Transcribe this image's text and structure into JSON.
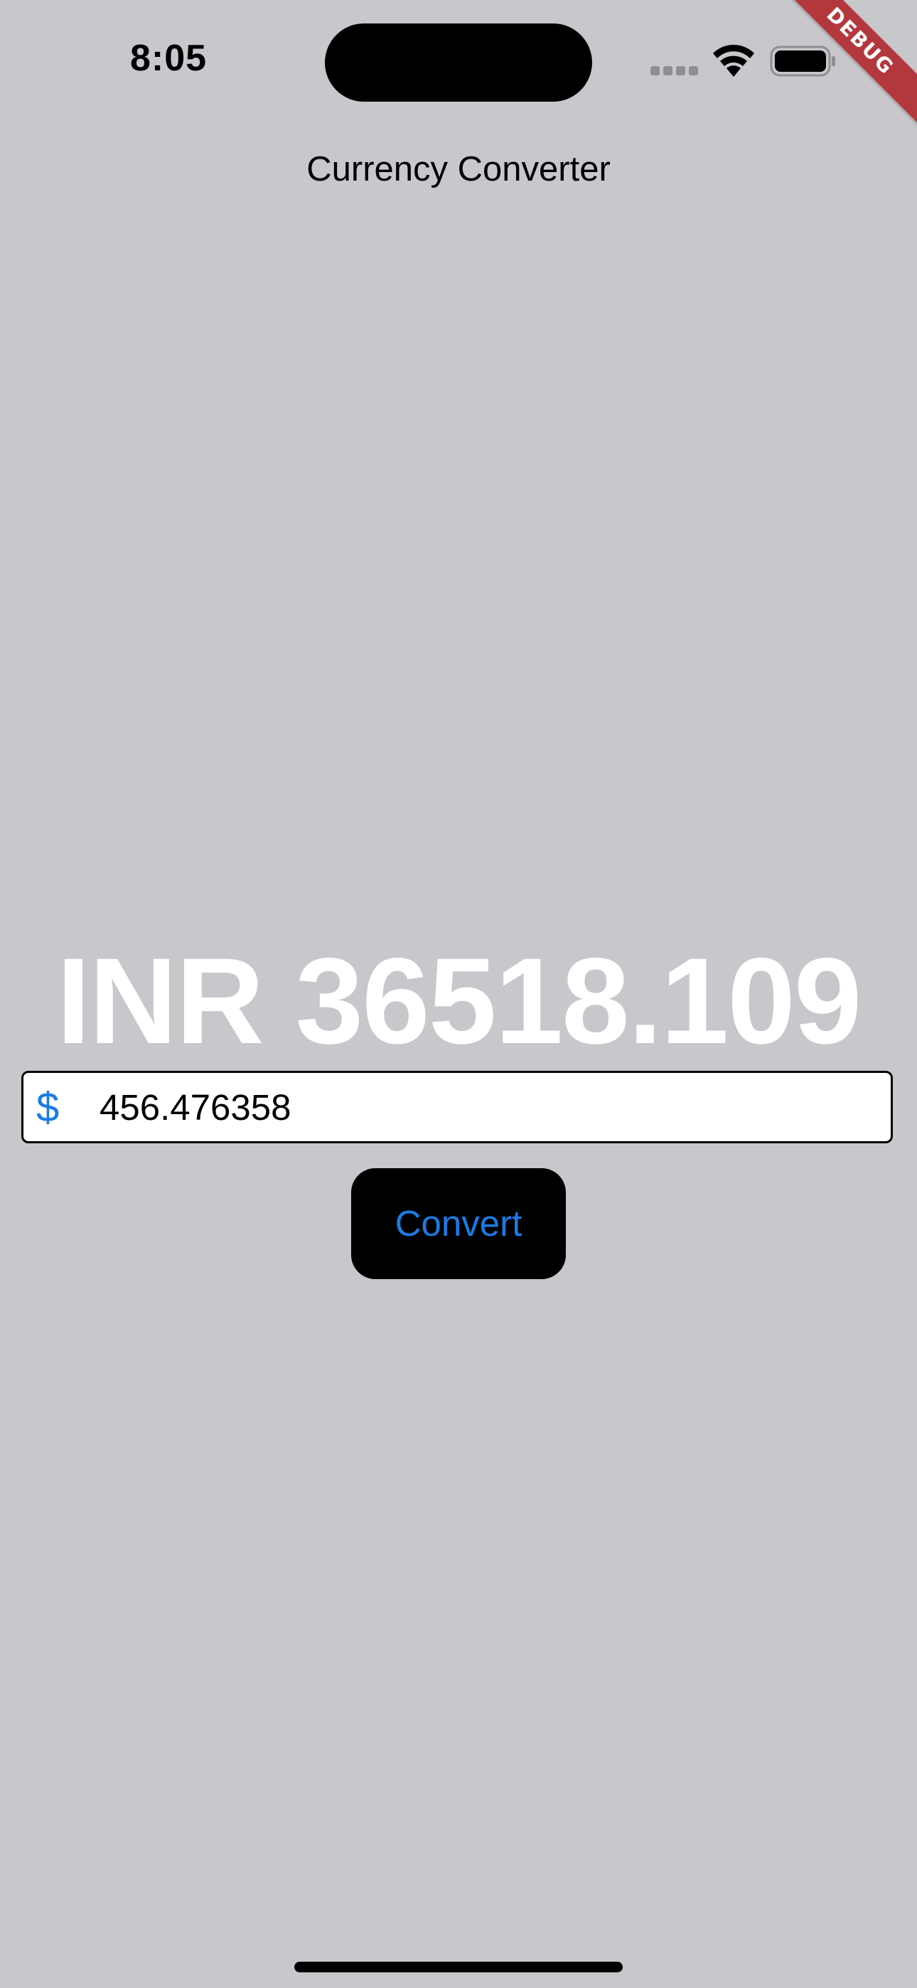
{
  "status_bar": {
    "time": "8:05",
    "icons": [
      "cellular-signal-icon",
      "wifi-icon",
      "battery-icon"
    ]
  },
  "debug_banner": {
    "label": "DEBUG",
    "color": "#b3383d"
  },
  "app_bar": {
    "title": "Currency Converter"
  },
  "result": {
    "text": "INR 36518.109"
  },
  "amount_field": {
    "prefix": "$",
    "value": "456.476358"
  },
  "convert_button": {
    "label": "Convert"
  },
  "colors": {
    "background": "#c8c7cc",
    "accent": "#1a7ce5",
    "result_text": "#ffffff",
    "button_background": "#000000"
  }
}
